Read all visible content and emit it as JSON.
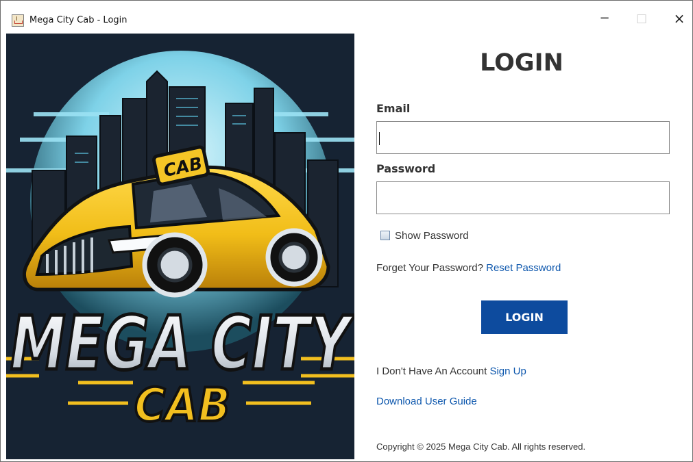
{
  "window": {
    "title": "Mega City Cab - Login",
    "controls": {
      "minimize": "−",
      "maximize": "□",
      "close": "×"
    }
  },
  "hero": {
    "badge": "CAB",
    "brand_line1": "MEGA CITY",
    "brand_line2": "CAB",
    "colors": {
      "background": "#162333",
      "sky": "#88d9ea",
      "taxi_yellow": "#f2bf1f",
      "text_silver": "#e5e8eb"
    }
  },
  "form": {
    "heading": "LOGIN",
    "email_label": "Email",
    "email_value": "",
    "password_label": "Password",
    "password_value": "",
    "show_password_label": "Show Password",
    "forgot_text": "Forget Your Password?",
    "reset_link": "Reset Password",
    "login_button": "LOGIN",
    "no_account_text": "I Don't Have An Account",
    "signup_link": "Sign Up",
    "guide_link": "Download User Guide",
    "copyright": "Copyright © 2025 Mega City Cab. All rights reserved.",
    "accent_color": "#0d4b9e"
  }
}
